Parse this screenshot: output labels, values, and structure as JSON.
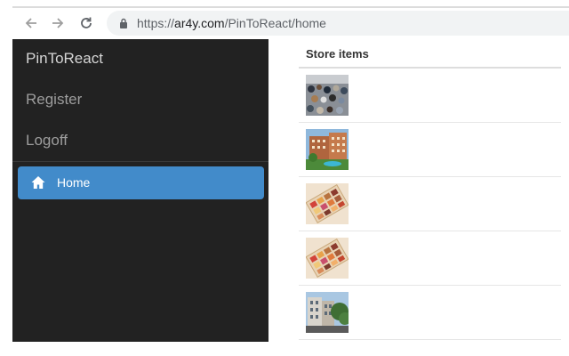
{
  "browser": {
    "url_scheme": "https://",
    "url_host": "ar4y.com",
    "url_path": "/PinToReact/home"
  },
  "sidebar": {
    "brand": "PinToReact",
    "links": [
      {
        "label": "Register"
      },
      {
        "label": "Logoff"
      }
    ],
    "active_item": {
      "label": "Home",
      "icon": "home-icon"
    }
  },
  "main": {
    "table_header": "Store items",
    "rows": [
      {
        "image": "crowd-photo"
      },
      {
        "image": "hotel-building-photo"
      },
      {
        "image": "eyeshadow-palette-photo"
      },
      {
        "image": "eyeshadow-palette-photo"
      },
      {
        "image": "street-building-photo"
      }
    ]
  },
  "colors": {
    "sidebar_bg": "#222222",
    "active_bg": "#428bca",
    "accent_text": "#ffffff"
  }
}
